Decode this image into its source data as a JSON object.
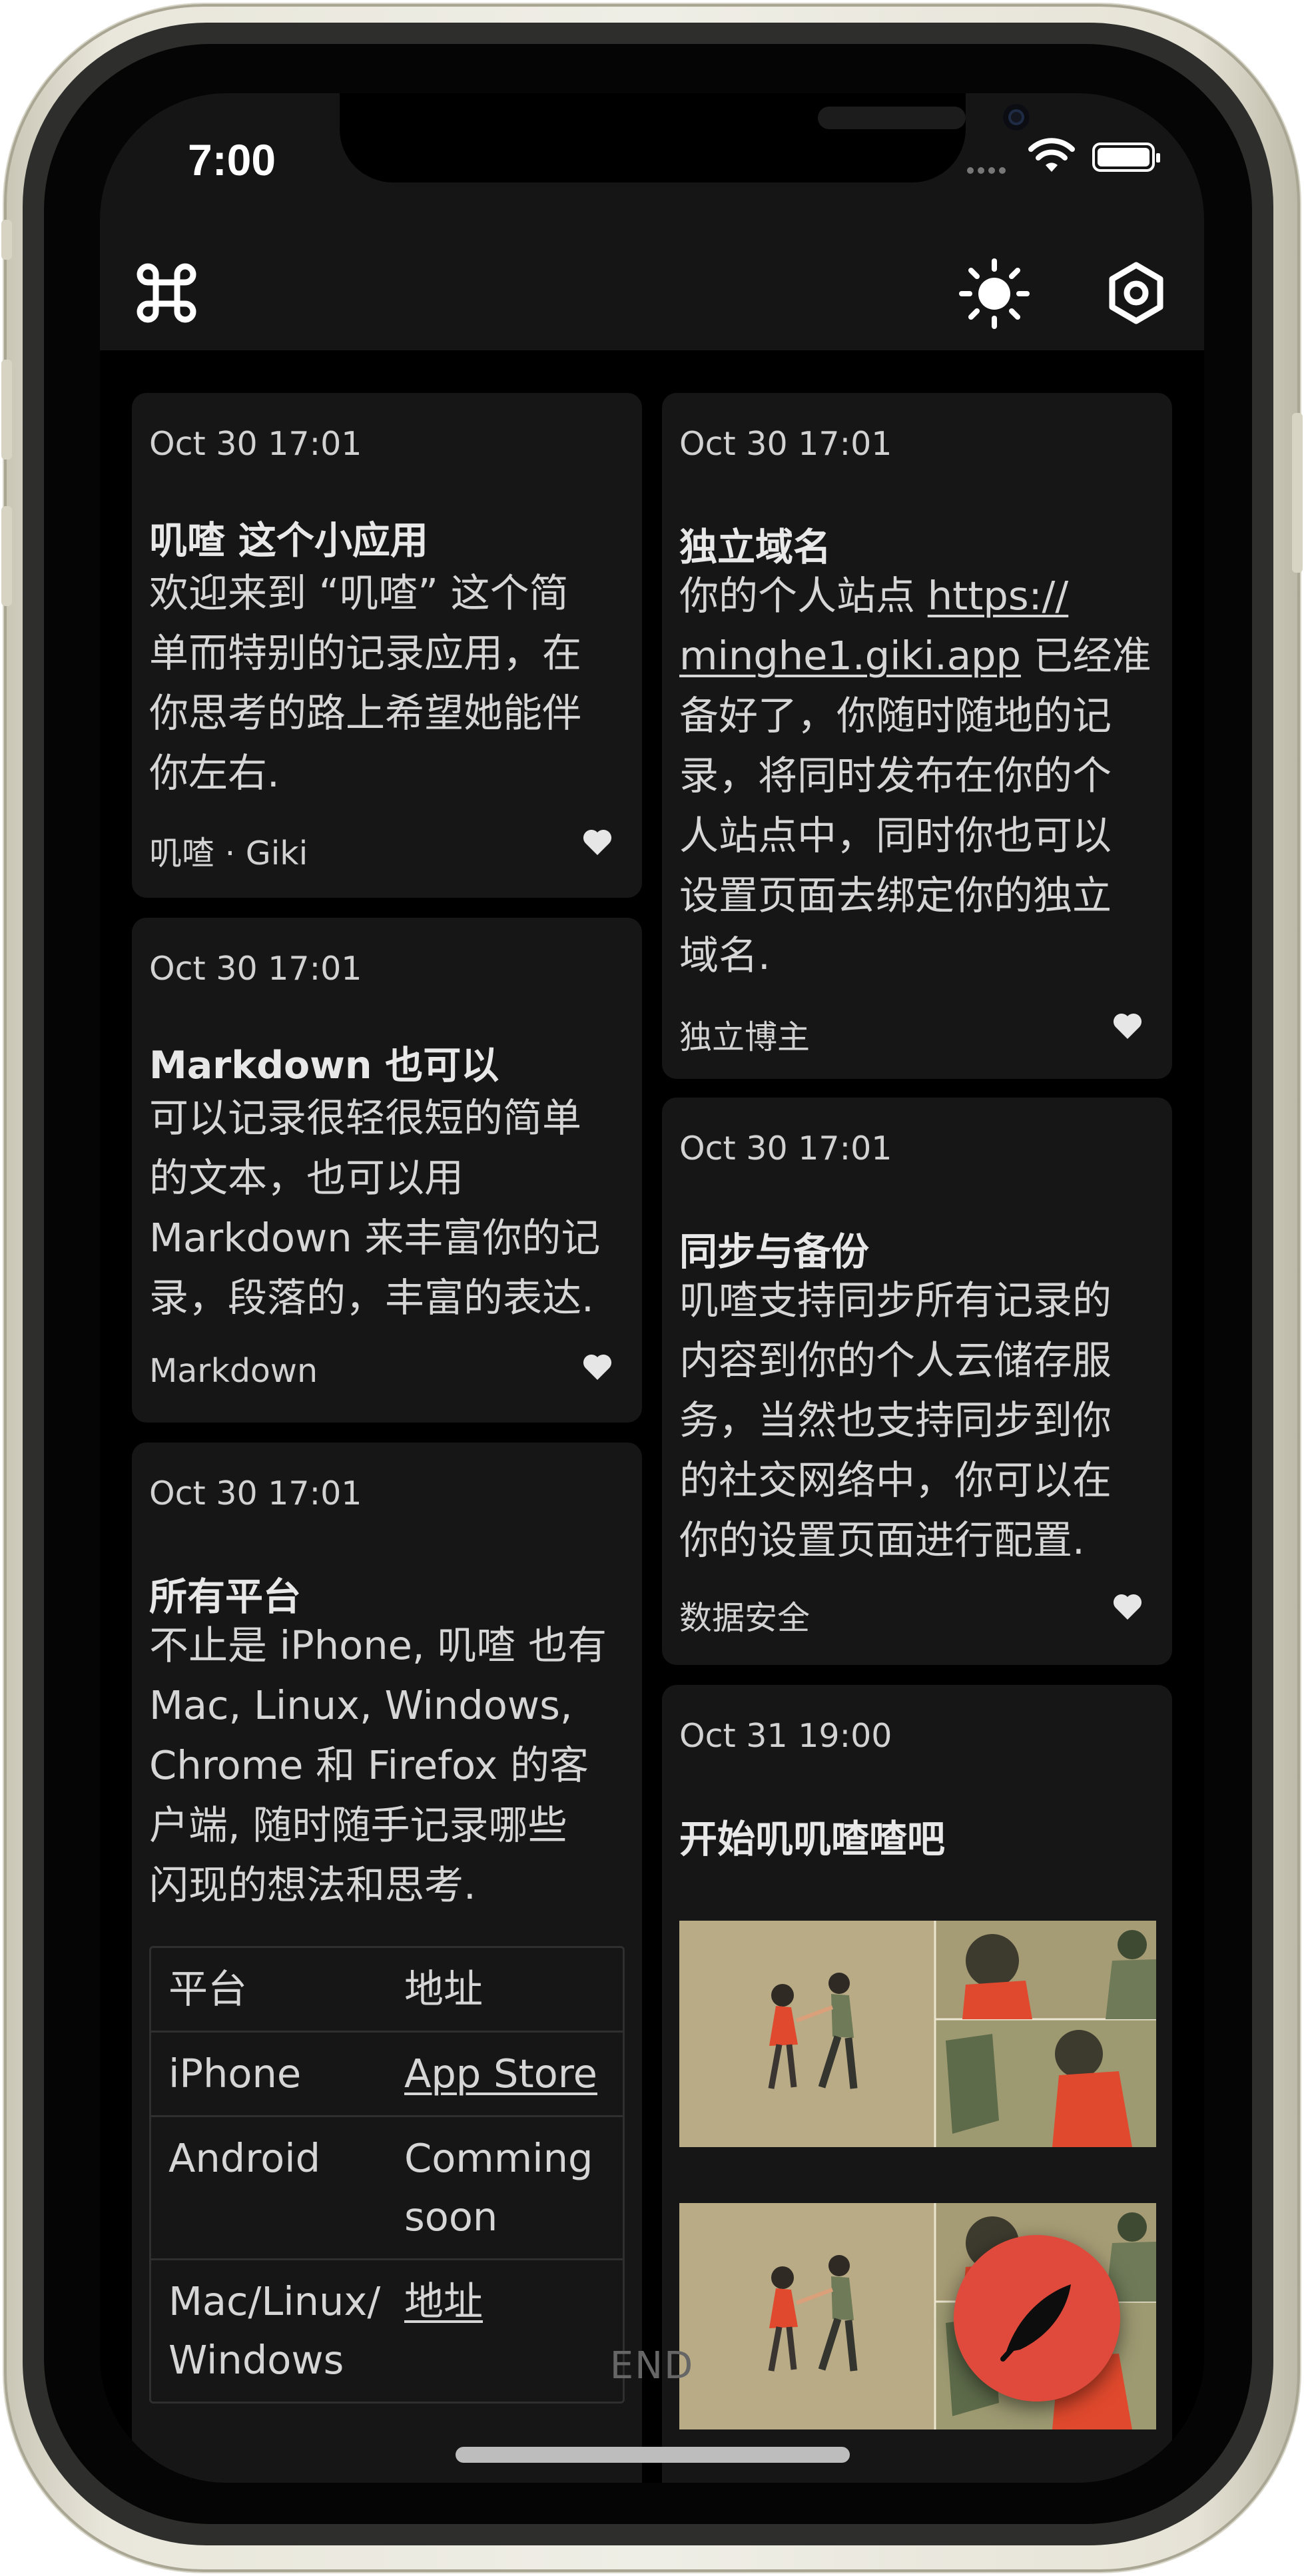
{
  "status_bar": {
    "time": "7:00"
  },
  "colors": {
    "background": "#000000",
    "card": "#161616",
    "fab": "#e04a3c",
    "text": "#d6d6d6"
  },
  "toolbar": {
    "left_icon": "command-icon",
    "theme_icon": "sun-icon",
    "settings_icon": "settings-icon"
  },
  "cards": {
    "c1": {
      "date": "Oct 30 17:01",
      "title": "叽喳 这个小应用",
      "lines": [
        "欢迎来到 “叽喳” 这个简",
        "单而特别的记录应用，在",
        "你思考的路上希望她能伴",
        "你左右."
      ],
      "tag": "叽喳 · Giki"
    },
    "c2": {
      "date": "Oct 30 17:01",
      "title": "Markdown 也可以",
      "lines": [
        "可以记录很轻很短的简单",
        "的文本，也可以用",
        "Markdown 来丰富你的记",
        "录，段落的，丰富的表达."
      ],
      "tag": "Markdown"
    },
    "c3": {
      "date": "Oct 30 17:01",
      "title": "所有平台",
      "lines": [
        "不止是 iPhone, 叽喳 也有",
        "Mac, Linux, Windows,",
        "Chrome 和 Firefox 的客",
        "户端, 随时随手记录哪些",
        "闪现的想法和思考."
      ],
      "table": {
        "headers": [
          "平台",
          "地址"
        ],
        "rows": [
          {
            "platform": "iPhone",
            "address": "App Store"
          },
          {
            "platform": "Android",
            "address": "Comming soon"
          },
          {
            "platform": "Mac/Linux/ Windows",
            "address": "地址"
          }
        ]
      }
    },
    "c4": {
      "date": "Oct 30 17:01",
      "title": "独立域名",
      "line1_prefix": "你的个人站点 ",
      "link_part1": "https://",
      "link_part2": "minghe1.giki.app",
      "line2_suffix": " 已经准",
      "lines": [
        "备好了，你随时随地的记",
        "录，将同时发布在你的个",
        "人站点中，同时你也可以",
        "设置页面去绑定你的独立",
        "域名."
      ],
      "tag": "独立博主"
    },
    "c5": {
      "date": "Oct 30 17:01",
      "title": "同步与备份",
      "lines": [
        "叽喳支持同步所有记录的",
        "内容到你的个人云储存服",
        "务，当然也支持同步到你",
        "的社交网络中，你可以在",
        "你的设置页面进行配置."
      ],
      "tag": "数据安全"
    },
    "c6": {
      "date": "Oct 31 19:00",
      "title": "开始叽叽喳喳吧",
      "images": [
        "dancing-couple-illustration",
        "dancing-couple-illustration"
      ]
    }
  },
  "end_label": "END",
  "fab_icon": "feather-pen-icon"
}
